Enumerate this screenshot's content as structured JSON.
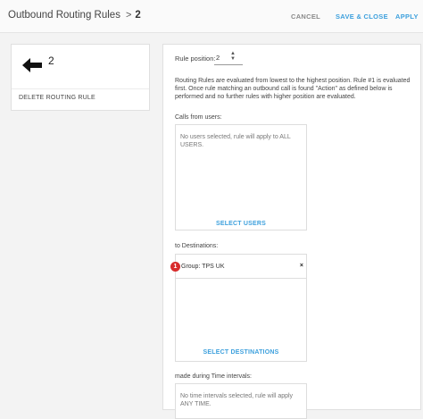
{
  "header": {
    "title": "Outbound Routing Rules",
    "separator": ">",
    "rule_number": "2",
    "cancel_label": "CANCEL",
    "save_close_label": "SAVE & CLOSE",
    "apply_label": "APPLY"
  },
  "left_panel": {
    "position_number": "2",
    "delete_label": "DELETE ROUTING RULE"
  },
  "form": {
    "rule_position_label": "Rule position:",
    "rule_position_value": "2",
    "description": "Routing Rules are evaluated from lowest to the highest position. Rule #1 is evaluated first. Once rule matching an outbound call is found \"Action\" as defined below is performed and no further rules with higher position are evaluated.",
    "calls_from_users_label": "Calls from users:",
    "users_empty_text": "No users selected, rule will apply to ALL USERS.",
    "select_users_label": "SELECT USERS",
    "to_destinations_label": "to Destinations:",
    "destinations": [
      {
        "badge": "1",
        "label": "Group: TPS UK",
        "remove": "×"
      }
    ],
    "select_destinations_label": "SELECT DESTINATIONS",
    "time_intervals_label": "made during Time intervals:",
    "time_empty_text": "No time intervals selected, rule will apply ANY TIME."
  },
  "colors": {
    "accent": "#3da0dd",
    "badge": "#d82c2c",
    "background": "#f3f3f3"
  }
}
